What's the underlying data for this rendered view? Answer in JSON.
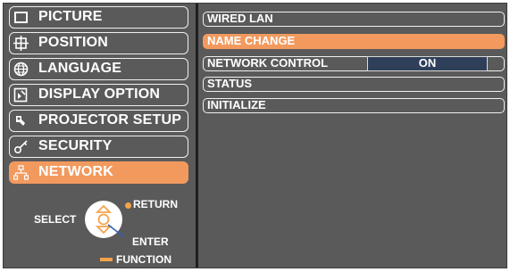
{
  "menu": {
    "items": [
      {
        "label": "PICTURE",
        "icon": "picture-icon"
      },
      {
        "label": "POSITION",
        "icon": "position-icon"
      },
      {
        "label": "LANGUAGE",
        "icon": "globe-icon"
      },
      {
        "label": "DISPLAY OPTION",
        "icon": "display-option-icon"
      },
      {
        "label": "PROJECTOR SETUP",
        "icon": "wrench-icon"
      },
      {
        "label": "SECURITY",
        "icon": "key-icon"
      },
      {
        "label": "NETWORK",
        "icon": "network-icon",
        "selected": true
      }
    ]
  },
  "submenu": {
    "items": [
      {
        "label": "WIRED LAN"
      },
      {
        "label": "NAME CHANGE",
        "selected": true
      },
      {
        "label": "NETWORK CONTROL",
        "value": "ON"
      },
      {
        "label": "STATUS"
      },
      {
        "label": "INITIALIZE"
      }
    ]
  },
  "guide": {
    "select": "SELECT",
    "return": "RETURN",
    "enter": "ENTER",
    "function": "FUNCTION"
  },
  "colors": {
    "background": "#5a5a5a",
    "accent": "#f29a5e",
    "value_bg": "#2f3f59",
    "text": "#ffffff"
  }
}
